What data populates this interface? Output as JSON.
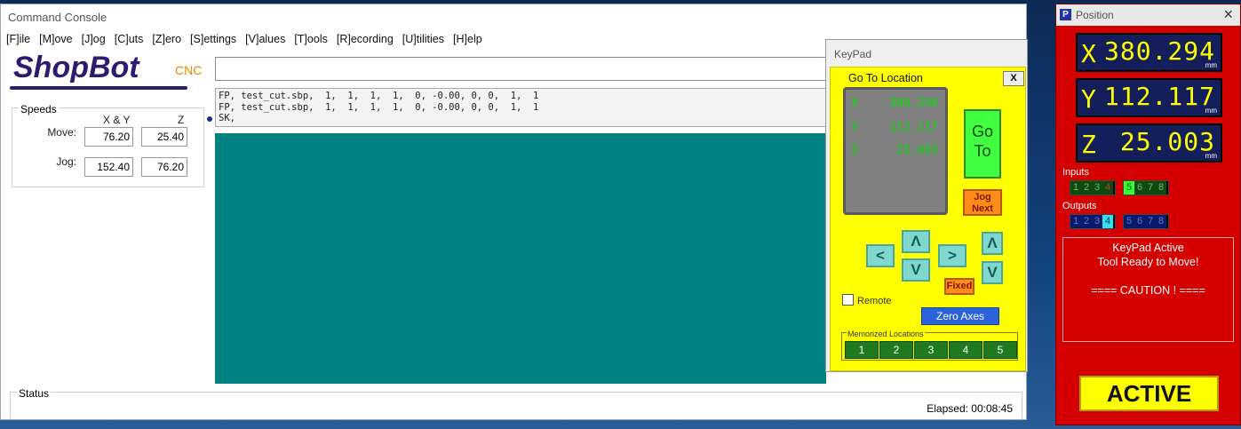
{
  "console": {
    "title": "Command Console",
    "menu": [
      "[F]ile",
      "[M]ove",
      "[J]og",
      "[C]uts",
      "[Z]ero",
      "[S]ettings",
      "[V]alues",
      "[T]ools",
      "[R]ecording",
      "[U]tilities",
      "[H]elp"
    ],
    "logo": {
      "brand": "ShopBot",
      "suffix": "CNC"
    },
    "speeds": {
      "legend": "Speeds",
      "col_xy": "X & Y",
      "col_z": "Z",
      "move_label": "Move:",
      "jog_label": "Jog:",
      "move_xy": "76.20",
      "move_z": "25.40",
      "jog_xy": "152.40",
      "jog_z": "76.20"
    },
    "command_input": "",
    "history": [
      "FP, test_cut.sbp,  1,  1,  1,  1,  0, -0.00, 0, 0,  1,  1",
      "FP, test_cut.sbp,  1,  1,  1,  1,  0, -0.00, 0, 0,  1,  1",
      "SK,"
    ],
    "status_legend": "Status",
    "elapsed": "Elapsed: 00:08:45",
    "colors": {
      "canvas": "#008080"
    }
  },
  "keypad": {
    "title": "KeyPad",
    "heading": "Go To Location",
    "close": "X",
    "display": [
      {
        "axis": "X",
        "value": "380.294"
      },
      {
        "axis": "Y",
        "value": "112.117"
      },
      {
        "axis": "Z",
        "value": "25.003"
      }
    ],
    "goto_l1": "Go",
    "goto_l2": "To",
    "jog_l1": "Jog",
    "jog_l2": "Next",
    "arrows": {
      "left": "<",
      "right": ">",
      "up": "Λ",
      "down": "V",
      "z_up": "Λ",
      "z_down": "V"
    },
    "fixed": "Fixed",
    "remote": "Remote",
    "zero_axes": "Zero Axes",
    "memorized_label": "Memorized Locations",
    "memorized": [
      "1",
      "2",
      "3",
      "4",
      "5"
    ]
  },
  "position": {
    "title": "Position",
    "close": "×",
    "x": {
      "axis": "X",
      "value": "380.294",
      "unit": "mm"
    },
    "y": {
      "axis": "Y",
      "value": "112.117",
      "unit": "mm"
    },
    "z": {
      "axis": "Z",
      "value": "25.003",
      "unit": "mm"
    },
    "inputs_label": "Inputs",
    "inputs": [
      "1",
      "2",
      "3",
      "4",
      "5",
      "6",
      "7",
      "8"
    ],
    "outputs_label": "Outputs",
    "outputs": [
      "1",
      "2",
      "3",
      "4",
      "5",
      "6",
      "7",
      "8"
    ],
    "message_lines": [
      "KeyPad Active",
      "Tool Ready to Move!",
      "",
      "==== CAUTION ! ===="
    ],
    "active": "ACTIVE",
    "colors": {
      "background": "#d40000",
      "dro_digits": "#ffff00",
      "active": "#ffff00"
    }
  }
}
